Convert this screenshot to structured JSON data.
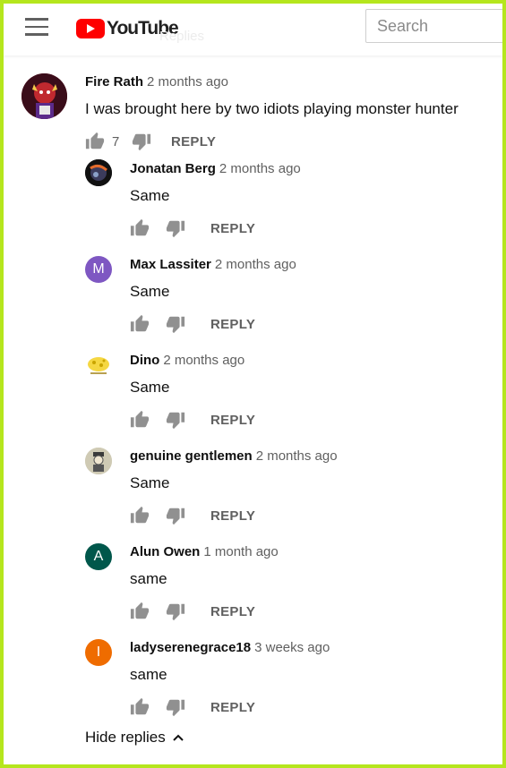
{
  "header": {
    "ghost_text": "Replies",
    "logo_text": "YouTube",
    "search_placeholder": "Search",
    "icons": {
      "menu": "hamburger-menu-icon",
      "logo": "youtube-play-icon"
    }
  },
  "colors": {
    "frame": "#b5e61d",
    "logo_red": "#ff0000",
    "meta_gray": "#606060"
  },
  "comment": {
    "author": "Fire Rath",
    "time": "2 months ago",
    "text": "I was brought here by two idiots playing monster hunter",
    "like_count": "7",
    "reply_label": "REPLY"
  },
  "replies": [
    {
      "author": "Jonatan Berg",
      "time": "2 months ago",
      "text": "Same",
      "reply_label": "REPLY",
      "avatar_letter": ""
    },
    {
      "author": "Max Lassiter",
      "time": "2 months ago",
      "text": "Same",
      "reply_label": "REPLY",
      "avatar_letter": "M",
      "avatar_color": "#7e57c2"
    },
    {
      "author": "Dino",
      "time": "2 months ago",
      "text": "Same",
      "reply_label": "REPLY",
      "avatar_letter": ""
    },
    {
      "author": "genuine gentlemen",
      "time": "2 months ago",
      "text": "Same",
      "reply_label": "REPLY",
      "avatar_letter": ""
    },
    {
      "author": "Alun Owen",
      "time": "1 month ago",
      "text": "same",
      "reply_label": "REPLY",
      "avatar_letter": "A",
      "avatar_color": "#00574b"
    },
    {
      "author": "ladyserenegrace18",
      "time": "3 weeks ago",
      "text": "same",
      "reply_label": "REPLY",
      "avatar_letter": "I",
      "avatar_color": "#ef6c00"
    }
  ],
  "hide_replies_label": "Hide replies"
}
